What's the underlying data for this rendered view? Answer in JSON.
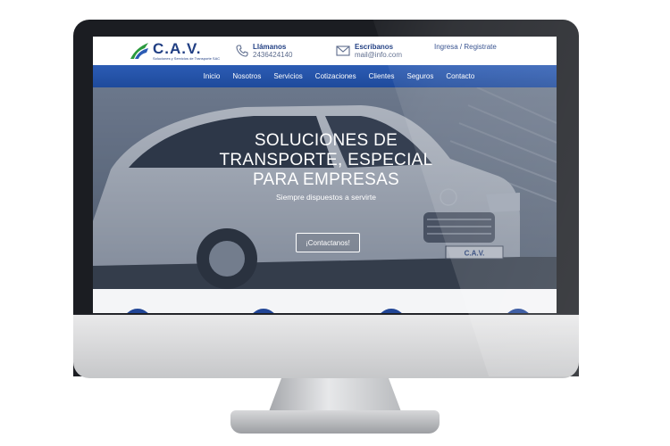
{
  "site": {
    "logo_text": "C.A.V.",
    "logo_subtext": "Soluciones y Servicios de Transporte SAC"
  },
  "header": {
    "phone_title": "Llámanos",
    "phone_value": "2436424140",
    "email_title": "Escribanos",
    "email_value": "mail@info.com",
    "login_label": "Ingresa / Registrate"
  },
  "nav": {
    "items": [
      "Inicio",
      "Nosotros",
      "Servicios",
      "Cotizaciones",
      "Clientes",
      "Seguros",
      "Contacto"
    ]
  },
  "hero": {
    "title_lines": [
      "SOLUCIONES DE",
      "TRANSPORTE, ESPECIAL",
      "PARA EMPRESAS"
    ],
    "subtitle": "Siempre dispuestos a servirte",
    "cta_label": "¡Contactanos!",
    "plate_text": "C.A.V."
  },
  "icons": {
    "phone": "phone-icon",
    "mail": "envelope-icon",
    "logo": "road-swoosh-logo"
  },
  "colors": {
    "brand_blue": "#213f83",
    "nav_blue": "#2c5cb4",
    "hero_overlay": "#2a3854"
  }
}
